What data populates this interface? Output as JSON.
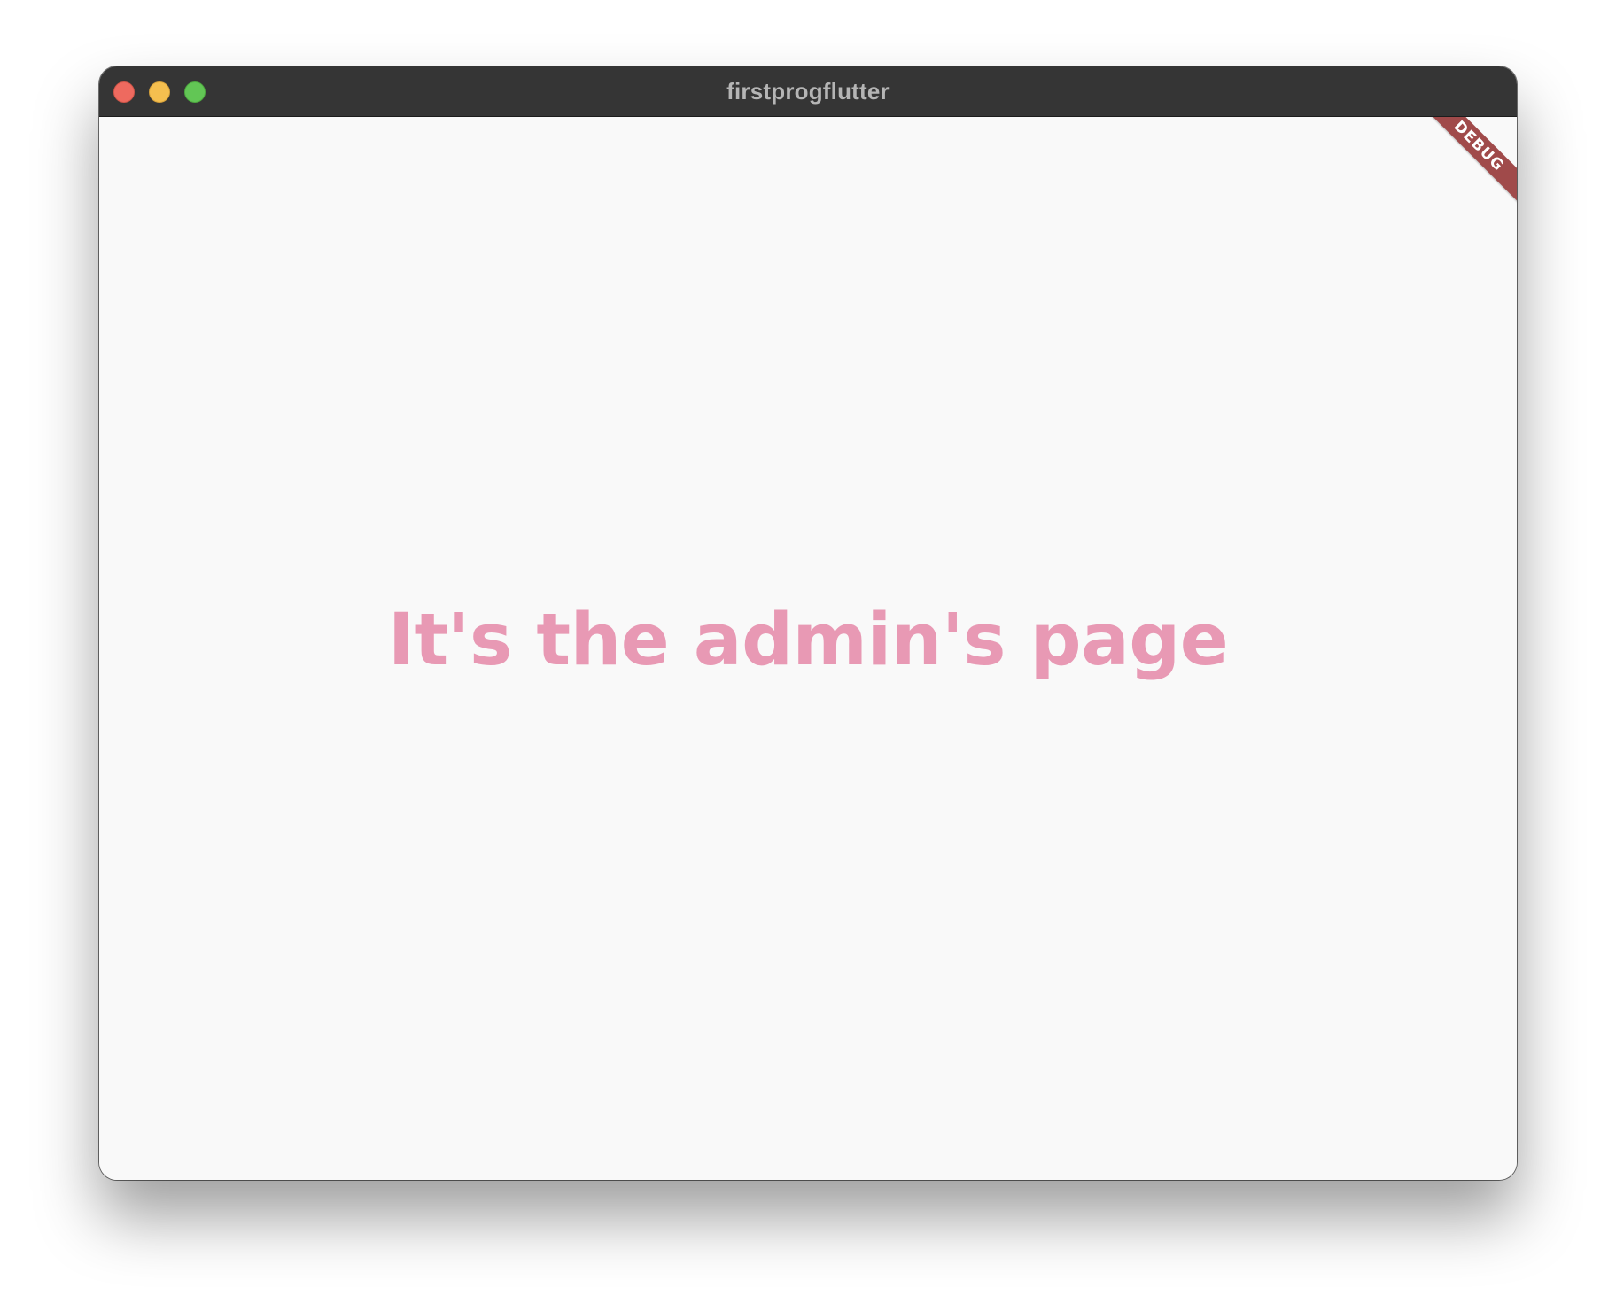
{
  "window": {
    "title": "firstprogflutter"
  },
  "traffic_lights": {
    "close": "close-icon",
    "minimize": "minimize-icon",
    "maximize": "maximize-icon",
    "colors": {
      "close": "#ee6a5f",
      "minimize": "#f5bf4f",
      "maximize": "#62c655"
    }
  },
  "content": {
    "headline": "It's the admin's page",
    "headline_color": "#e899b4",
    "background_color": "#f9f9f9"
  },
  "debug_banner": {
    "label": "DEBUG",
    "color": "#a04a4a"
  }
}
